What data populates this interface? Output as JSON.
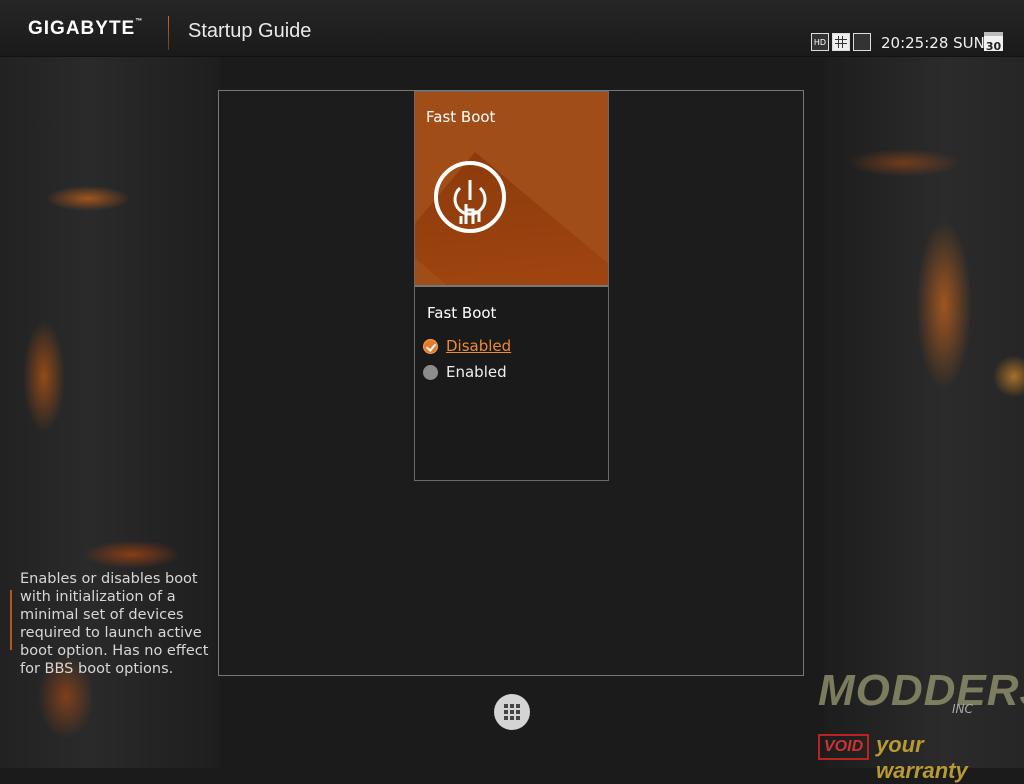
{
  "header": {
    "brand": "GIGABYTE",
    "brand_tm": "™",
    "title": "Startup Guide",
    "clock": "20:25:28 SUN",
    "calendar_day": "30",
    "icons": [
      "hd-icon",
      "grid-view-icon",
      "window-icon"
    ]
  },
  "card": {
    "header_label": "Fast Boot",
    "option_title": "Fast Boot",
    "options": [
      {
        "label": "Disabled",
        "selected": true
      },
      {
        "label": "Enabled",
        "selected": false
      }
    ]
  },
  "help_text": "Enables or disables boot with initialization of a minimal set of devices required to launch active boot option. Has no effect for BBS boot options.",
  "watermark": {
    "title": "MODDERS",
    "inc": "INC",
    "void": "VOID",
    "tagline": "your warranty"
  },
  "colors": {
    "accent": "#e87a2a",
    "card_bg": "#a14d17"
  }
}
